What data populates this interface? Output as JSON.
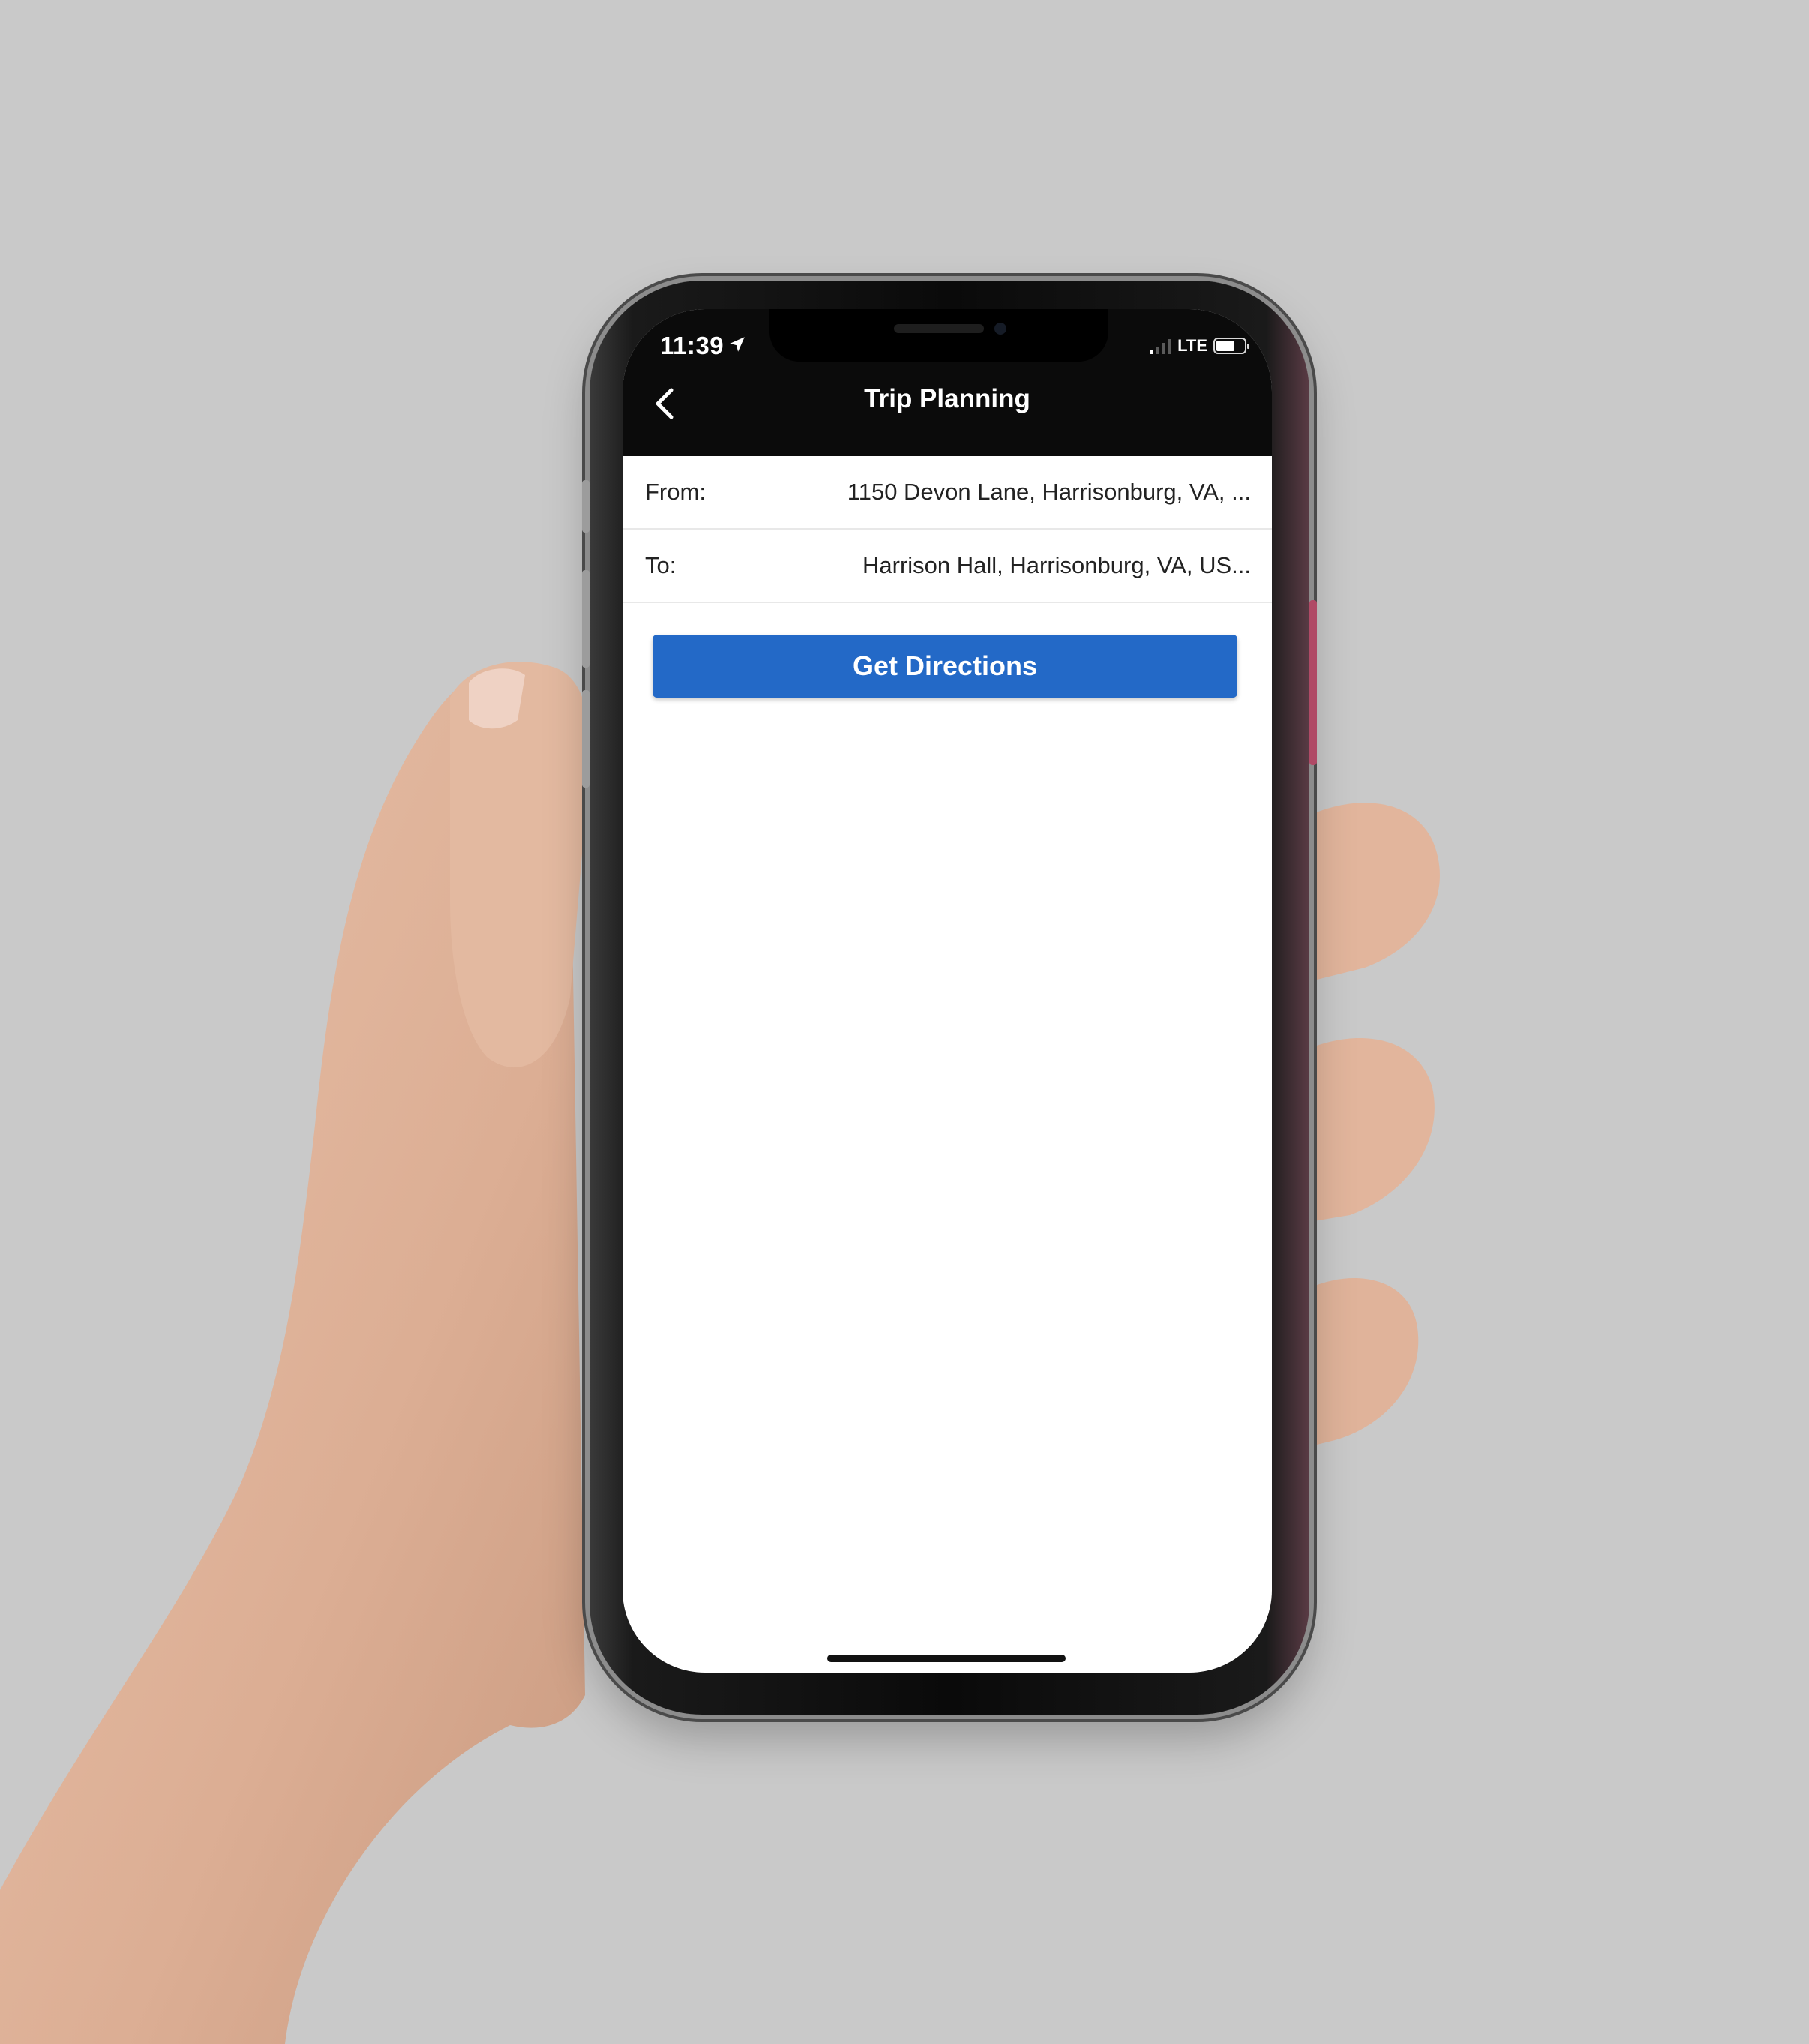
{
  "status_bar": {
    "time": "11:39",
    "network": "LTE",
    "signal_icon": "cellular-signal-icon",
    "location_icon": "location-arrow-icon",
    "battery_icon": "battery-icon"
  },
  "nav": {
    "title": "Trip Planning",
    "back_icon": "chevron-left-icon"
  },
  "form": {
    "from_label": "From:",
    "from_value": "1150 Devon Lane, Harrisonburg, VA, ...",
    "to_label": "To:",
    "to_value": "Harrison Hall, Harrisonburg, VA, US..."
  },
  "actions": {
    "get_directions_label": "Get Directions"
  },
  "colors": {
    "background": "#c9c9c9",
    "nav_bar": "#0b0b0b",
    "primary_button": "#2369c7",
    "screen": "#ffffff"
  }
}
